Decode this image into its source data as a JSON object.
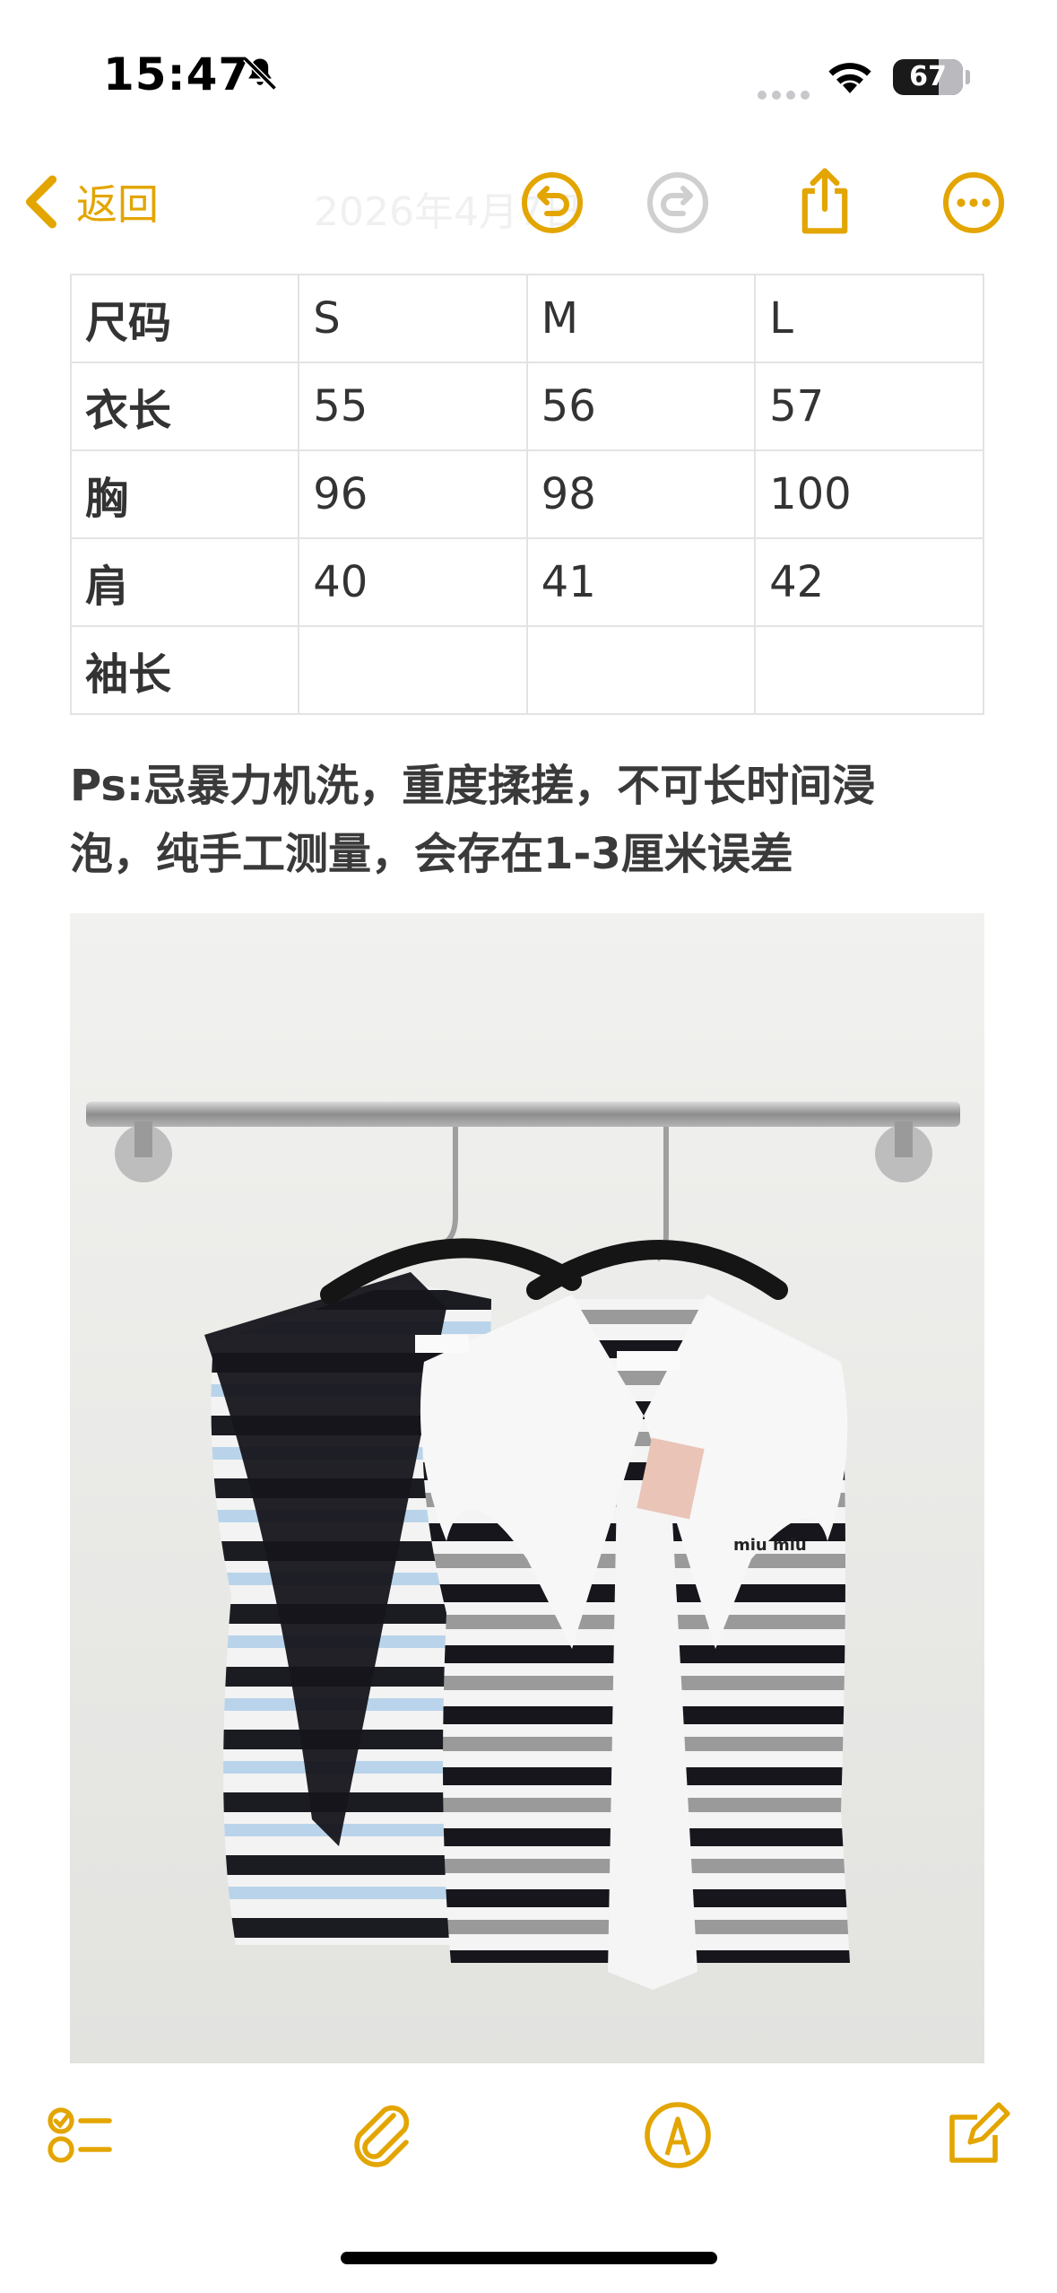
{
  "status_bar": {
    "time": "15:47",
    "battery": "67",
    "icons": [
      "bell-slash-icon",
      "signal-icon",
      "wifi-icon",
      "battery-icon"
    ]
  },
  "nav": {
    "back_label": "返回",
    "title": "2026年4月7日",
    "icons": [
      "chevron-left-icon",
      "undo-icon",
      "redo-icon",
      "share-icon",
      "more-icon"
    ],
    "accent_color": "#e3a500"
  },
  "size_table": {
    "rows": [
      [
        "尺码",
        "S",
        "M",
        "L"
      ],
      [
        "衣长",
        "55",
        "56",
        "57"
      ],
      [
        "胸",
        "96",
        "98",
        "100"
      ],
      [
        "肩",
        "40",
        "41",
        "42"
      ],
      [
        "袖长",
        "",
        "",
        ""
      ]
    ]
  },
  "note": {
    "line1": "Ps:忌暴力机洗，重度揉搓，不可长时间浸",
    "line2": "泡，纯手工测量，会存在1-3厘米误差"
  },
  "photo": {
    "label_tag": "miu miu"
  },
  "toolbar": {
    "icons": [
      "checklist-icon",
      "paperclip-icon",
      "markup-pen-icon",
      "compose-icon"
    ]
  }
}
